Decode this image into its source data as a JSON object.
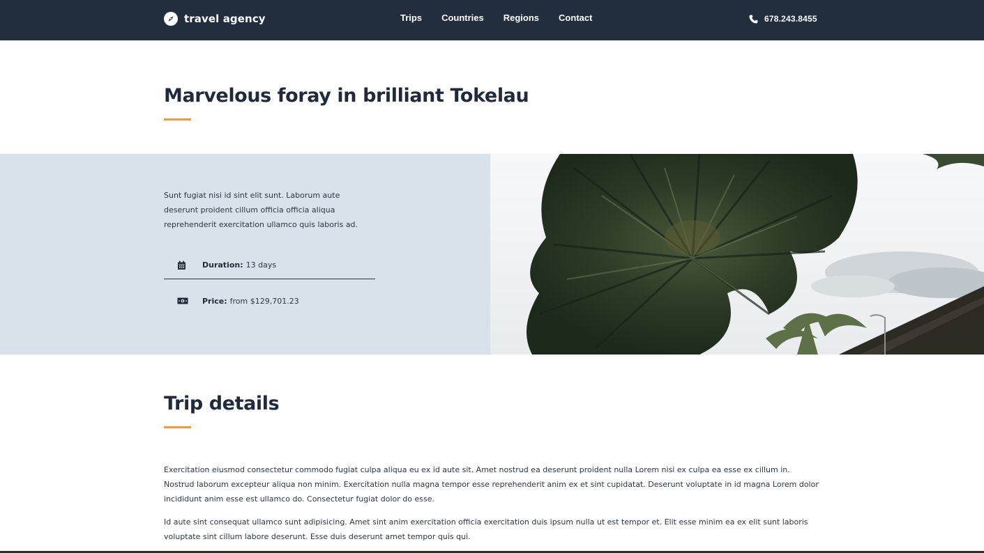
{
  "brand": {
    "name": "travel agency",
    "icon": "compass-icon"
  },
  "nav": {
    "items": [
      {
        "label": "Trips"
      },
      {
        "label": "Countries"
      },
      {
        "label": "Regions"
      },
      {
        "label": "Contact"
      }
    ]
  },
  "contact": {
    "phone": "678.243.8455",
    "icon": "phone-icon"
  },
  "page": {
    "title": "Marvelous foray in brilliant Tokelau"
  },
  "hero": {
    "description": "Sunt fugiat nisi id sint elit sunt. Laborum aute deserunt proident cillum officia officia aliqua reprehenderit exercitation ullamco quis laboris ad.",
    "duration": {
      "label": "Duration:",
      "value": "13 days",
      "icon": "calendar-icon"
    },
    "price": {
      "label": "Price:",
      "value": "from $129,701.23",
      "icon": "money-icon"
    },
    "image": "palm-trees-photo"
  },
  "details": {
    "title": "Trip details",
    "paragraphs": [
      "Exercitation eiusmod consectetur commodo fugiat culpa aliqua eu ex id aute sit. Amet nostrud ea deserunt proident nulla Lorem nisi ex culpa ea esse ex cillum in. Nostrud laborum excepteur aliqua non minim. Exercitation nulla magna tempor esse reprehenderit anim ex et sint cupidatat. Deserunt voluptate in id magna Lorem dolor incididunt anim esse est ullamco do. Consectetur fugiat dolor do esse.",
      "Id aute sint consequat ullamco sunt adipisicing. Amet sint anim exercitation officia exercitation duis ipsum nulla ut est tempor et. Elit esse minim ea ex elit sunt laboris voluptate sint cillum labore deserunt. Esse duis deserunt amet tempor quis qui."
    ]
  },
  "colors": {
    "navbar": "#222d3e",
    "accent": "#f09a3c",
    "panel": "#d9e1ea",
    "text": "#1f2a3a"
  }
}
